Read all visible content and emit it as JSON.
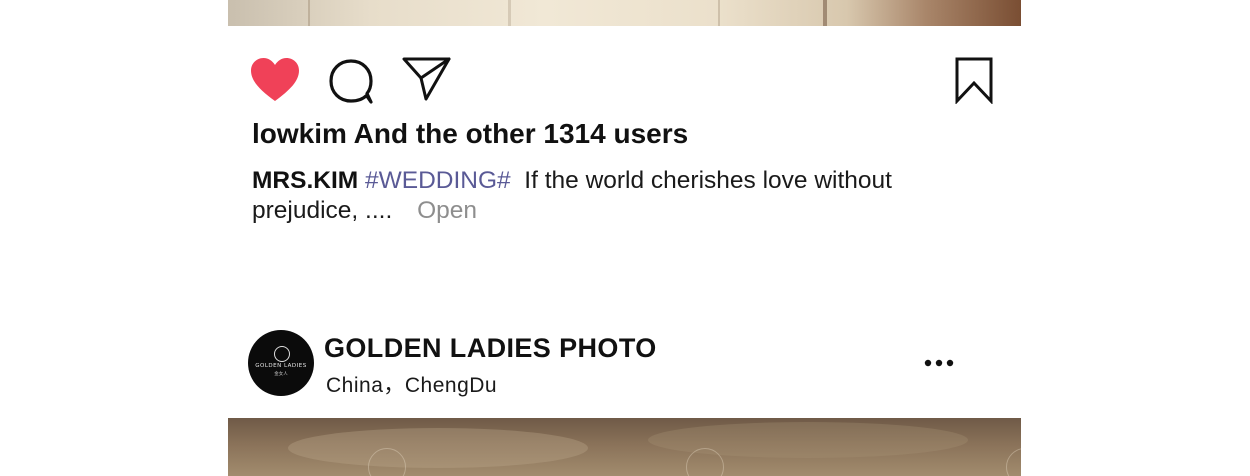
{
  "post_actions": {
    "like_icon": "heart-filled-icon",
    "comment_icon": "comment-bubble-icon",
    "share_icon": "paper-plane-icon",
    "bookmark_icon": "bookmark-icon",
    "like_color": "#f04158"
  },
  "likes": {
    "text": "lowkim And the other 1314 users"
  },
  "caption": {
    "author": "MRS.KIM",
    "hashtag": "#WEDDING#",
    "text": "If the world cherishes love without prejudice, ....",
    "more_label": "Open",
    "hashtag_color": "#5a5a96"
  },
  "next_post": {
    "account_name": "GOLDEN LADIES PHOTO",
    "location": "China，ChengDu",
    "avatar_logo_text": "GOLDEN LADIES",
    "avatar_logo_sub": "金女人",
    "more_icon": "more-horizontal-icon"
  }
}
